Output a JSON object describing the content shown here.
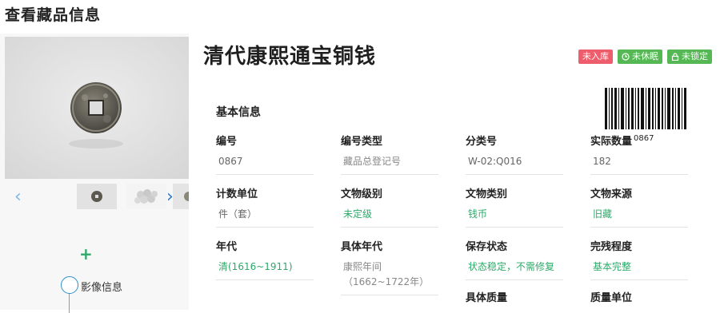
{
  "page": {
    "title": "查看藏品信息"
  },
  "item": {
    "title": "清代康熙通宝铜钱",
    "badges": [
      {
        "text": "未入库",
        "color": "#ee5d6b"
      },
      {
        "text": "未休眠",
        "color": "#55b855",
        "icon": "clock-icon"
      },
      {
        "text": "未锁定",
        "color": "#55b855",
        "icon": "lock-icon"
      }
    ]
  },
  "gallery": {
    "prev_icon": "chevron-left-icon",
    "next_icon": "chevron-right-icon"
  },
  "timeline": {
    "add_icon": "plus-icon",
    "label": "影像信息"
  },
  "basic": {
    "section_title": "基本信息",
    "barcode_number": "0867",
    "fields": [
      {
        "label": "编号",
        "value": "0867"
      },
      {
        "label": "编号类型",
        "value": "藏品总登记号"
      },
      {
        "label": "分类号",
        "value": "W-02:Q016"
      },
      {
        "label": "实际数量",
        "value": "182"
      },
      {
        "label": "计数单位",
        "value": "件（套）"
      },
      {
        "label": "文物级别",
        "value": "未定级"
      },
      {
        "label": "文物类别",
        "value": "钱币"
      },
      {
        "label": "文物来源",
        "value": "旧藏"
      },
      {
        "label": "年代",
        "value": "清(1616~1911)"
      },
      {
        "label": "具体年代",
        "value": "康熙年间",
        "value2": "（1662~1722年）"
      },
      {
        "label": "保存状态",
        "value": "状态稳定，不需修复"
      },
      {
        "label": "完残程度",
        "value": "基本完整"
      },
      {
        "label": "具体质量",
        "value": ""
      },
      {
        "label": "质量单位",
        "value": ""
      }
    ]
  },
  "colors": {
    "accent_green": "#2daa6a",
    "badge_red": "#ee5d6b",
    "badge_green": "#55b855",
    "link_blue": "#2e79c8"
  }
}
